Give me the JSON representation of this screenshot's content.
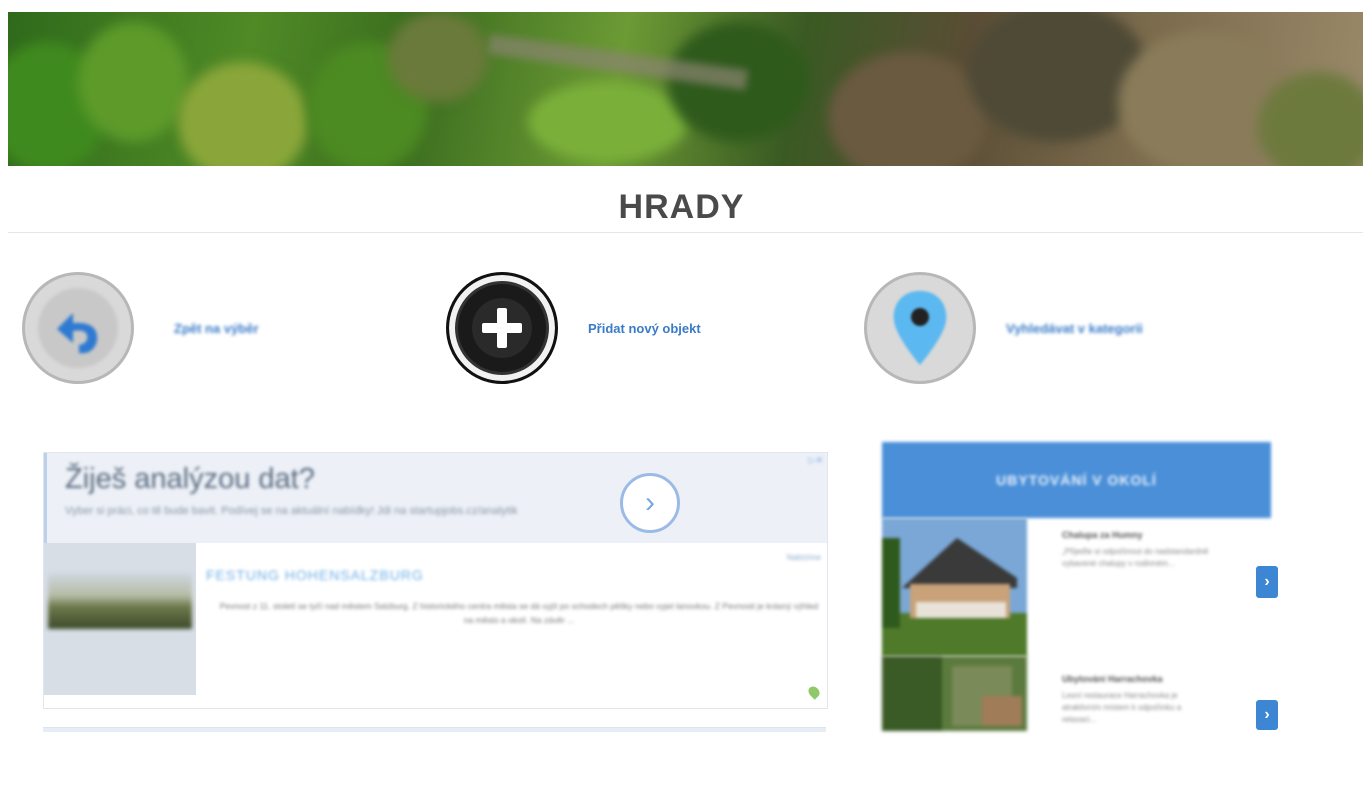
{
  "page": {
    "title": "HRADY"
  },
  "actions": [
    {
      "label": "Zpět na výběr",
      "icon": "back-arrow-icon"
    },
    {
      "label": "Přidat nový objekt",
      "icon": "plus-icon"
    },
    {
      "label": "Vyhledávat v kategorii",
      "icon": "map-pin-icon"
    }
  ],
  "ad": {
    "headline": "Žiješ analýzou dat?",
    "subtext": "Vyber si práci, co tě bude bavit. Podívej se na aktuální nabídky! Jdi na startupjobs.cz/analytik",
    "close": "▷✕",
    "sponsor": "Nabízíme",
    "card_title": "FESTUNG HOHENSALZBURG",
    "card_text": "Pevnost z 11. století se tyčí nad městem Salzburg. Z historického centra města se dá vyjít po schodech pěšky nebo vyjet lanovkou. Z Pevnosti je krásný výhled na město a okolí. Na závěr ..."
  },
  "sidebar": {
    "heading": "UBYTOVÁNÍ V OKOLÍ",
    "items": [
      {
        "name": "Chalupa za Humny",
        "desc": "„Přijeďte si odpočinout do nadstandardně vybavené chalupy v rodinném...",
        "button": "›"
      },
      {
        "name": "Ubytování Harrachovka",
        "desc": "Lesní restaurace Harrachovka je atraktivním místem k odpočinku a relaxaci...",
        "button": "›"
      }
    ]
  },
  "colors": {
    "accent": "#4a8fd8",
    "link": "#3a7bc8",
    "title": "#4a4a4a"
  }
}
